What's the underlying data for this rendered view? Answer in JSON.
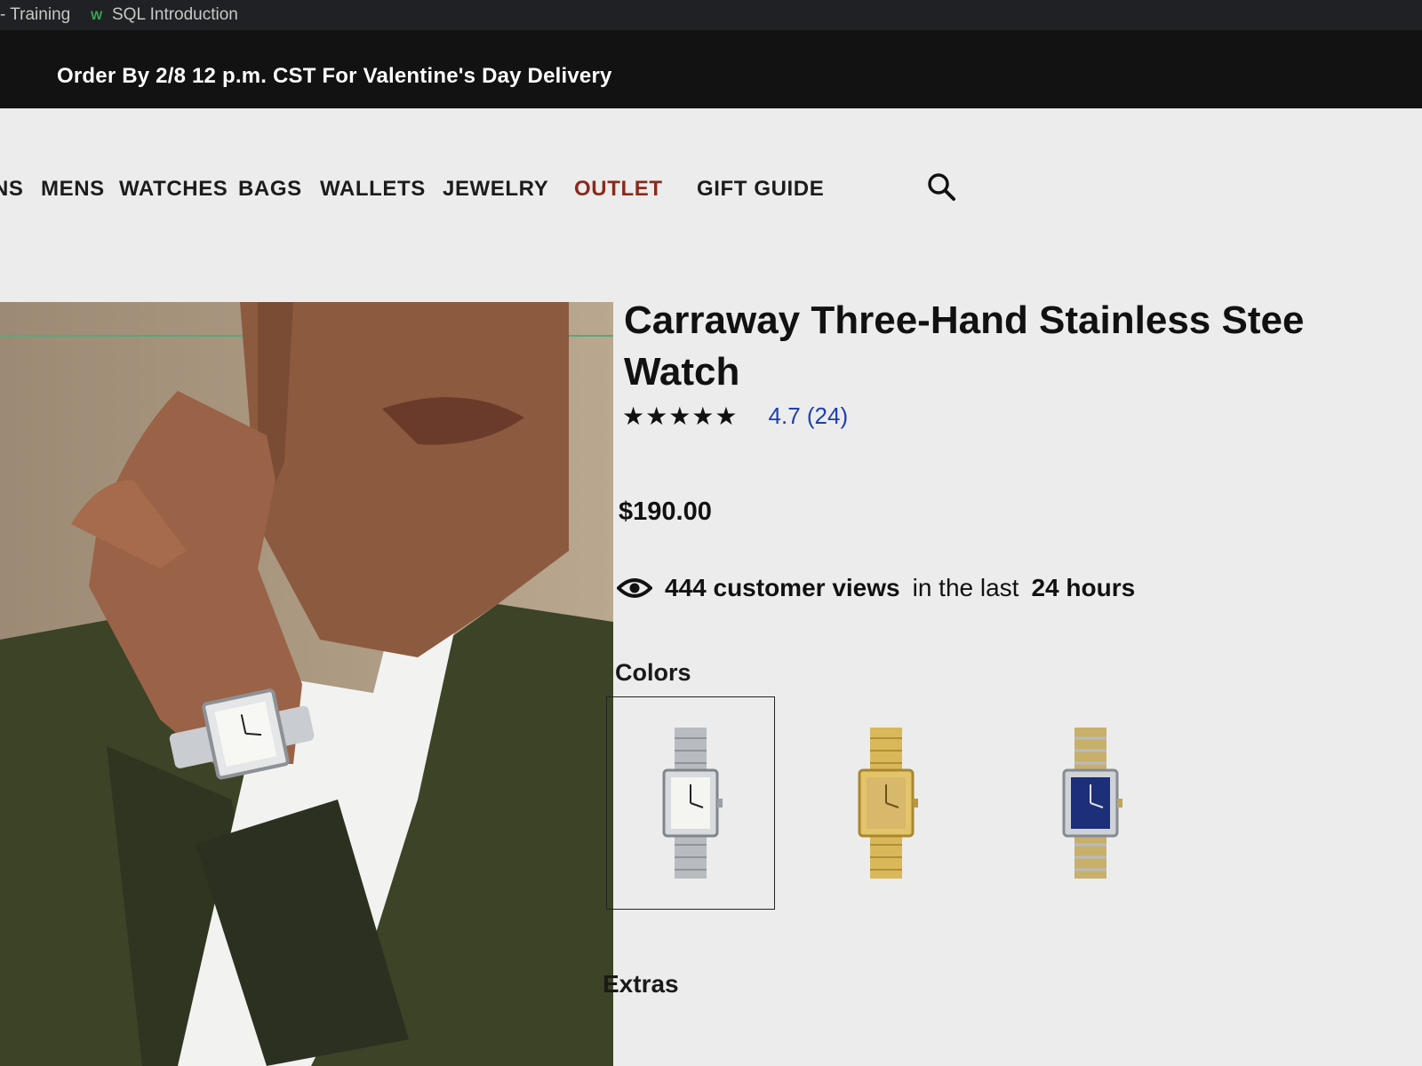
{
  "browser": {
    "bookmarks": [
      {
        "label": "- Training",
        "icon": "none"
      },
      {
        "label": "SQL Introduction",
        "icon": "w-favicon"
      }
    ]
  },
  "promo": {
    "text": "Order By 2/8 12 p.m. CST For Valentine's Day Delivery"
  },
  "nav": {
    "items": [
      {
        "label": "NS"
      },
      {
        "label": "MENS"
      },
      {
        "label": "WATCHES"
      },
      {
        "label": "BAGS"
      },
      {
        "label": "WALLETS"
      },
      {
        "label": "JEWELRY"
      },
      {
        "label": "OUTLET",
        "color": "#8a2a1c"
      },
      {
        "label": "GIFT GUIDE"
      }
    ],
    "search_icon": "search-icon"
  },
  "product": {
    "title_line1": "Carraway Three-Hand Stainless Stee",
    "title_line2": "Watch",
    "stars": "★★★★★",
    "rating_text": "4.7 (24)",
    "rating_value": 4.7,
    "price": "$190.00",
    "views_count": "444 customer views",
    "views_mid": "in the last",
    "views_period": "24 hours",
    "colors_label": "Colors",
    "extras_label": "Extras",
    "swatches": [
      {
        "name": "silver",
        "selected": true
      },
      {
        "name": "gold",
        "selected": false
      },
      {
        "name": "two-tone-blue",
        "selected": false
      }
    ]
  },
  "colors": {
    "rating_link": "#1f3fb0",
    "outlet": "#8a2a1c",
    "banner_bg": "#121212"
  }
}
